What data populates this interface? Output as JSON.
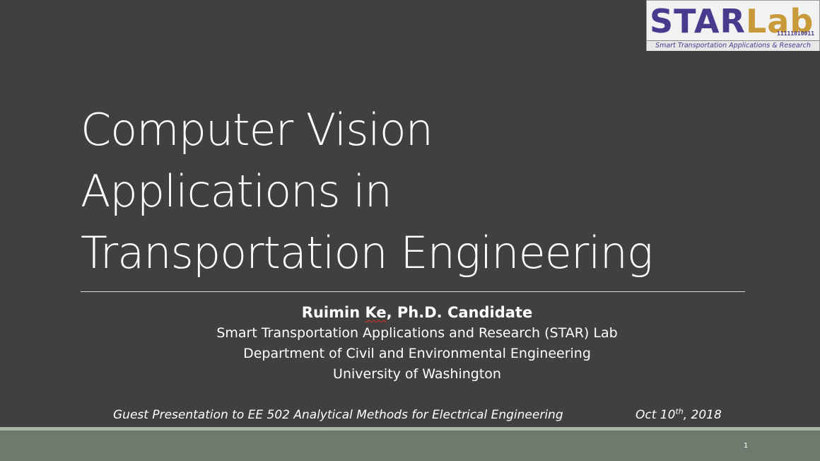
{
  "logo": {
    "word_star": "STAR",
    "word_lab": "Lab",
    "binary": "11111010011",
    "tagline": "Smart Transportation Applications & Research"
  },
  "title": {
    "line1": "Computer Vision",
    "line2": "Applications in",
    "line3": "Transportation Engineering"
  },
  "presenter": {
    "name_first": "Ruimin ",
    "name_last": "Ke",
    "name_suffix": ", Ph.D. Candidate",
    "lab": "Smart Transportation Applications and Research (STAR) Lab",
    "department": "Department of Civil and Environmental Engineering",
    "university": "University of Washington"
  },
  "footer": {
    "guest_line": "Guest Presentation to EE 502 Analytical Methods for Electrical Engineering",
    "date_prefix": "Oct 10",
    "date_sup": "th",
    "date_suffix": ", 2018",
    "page_number": "1"
  },
  "colors": {
    "background": "#404040",
    "footer_band": "#6c7b6d",
    "footer_strip": "#a6b5a6",
    "logo_purple": "#4a3a8e",
    "logo_gold": "#c89a3a"
  }
}
